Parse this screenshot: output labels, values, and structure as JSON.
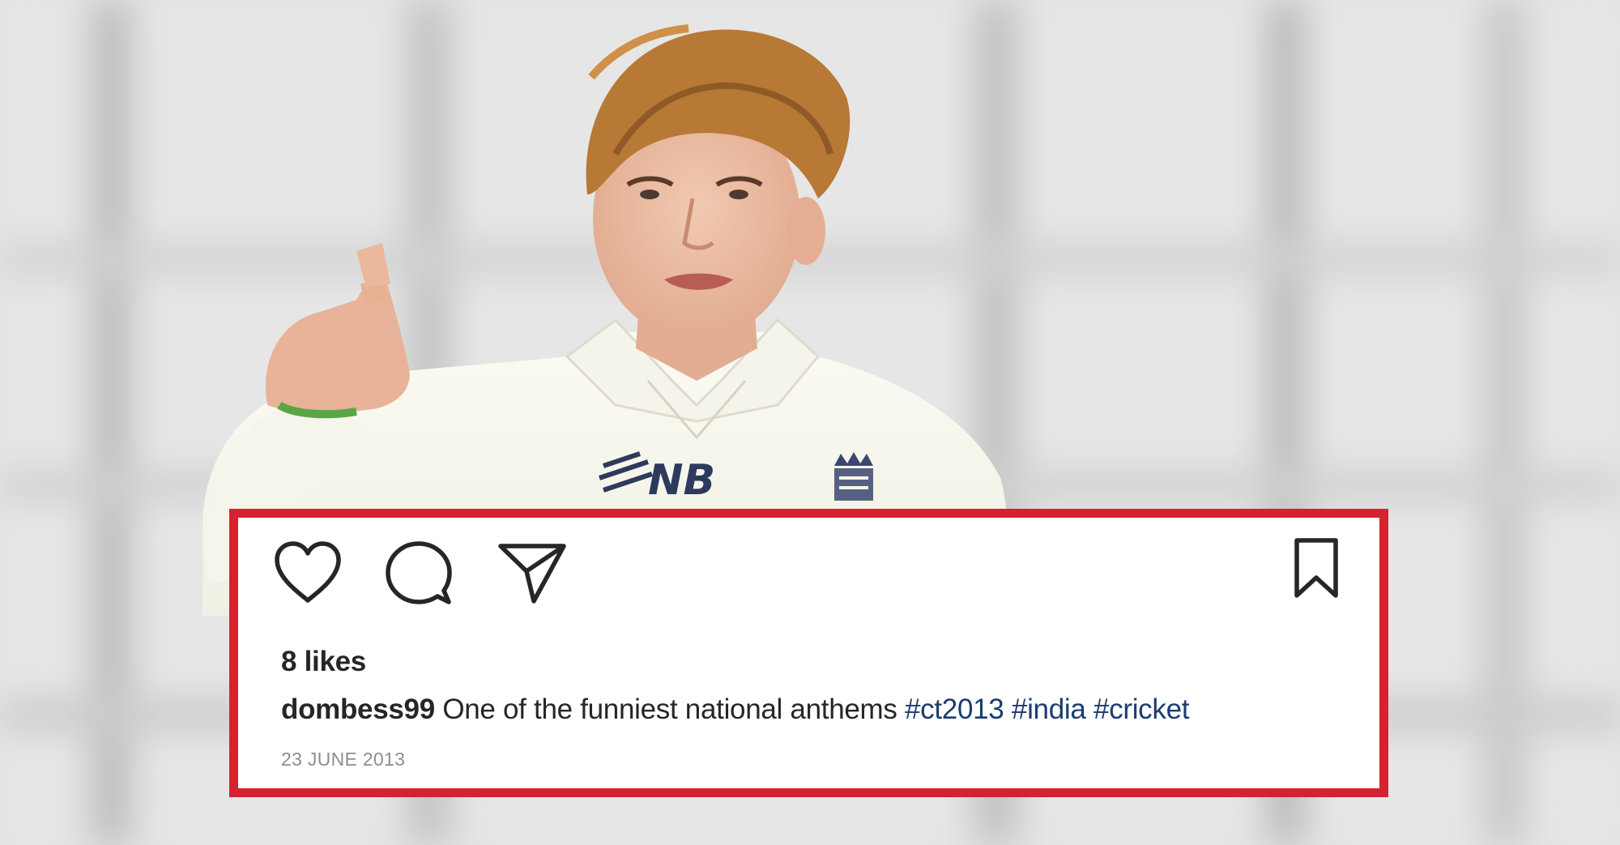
{
  "post": {
    "likes": "8 likes",
    "username": "dombess99",
    "caption_text": "One of the funniest national anthems",
    "hashtags": [
      "#ct2013",
      "#india",
      "#cricket"
    ],
    "date": "23 JUNE 2013"
  },
  "photo": {
    "shirt_logo_text": "NB"
  },
  "icons": {
    "like": "heart-icon",
    "comment": "comment-bubble-icon",
    "share": "paper-plane-icon",
    "save": "bookmark-icon"
  },
  "colors": {
    "border": "#d52130",
    "card": "#ffffff",
    "text": "#262626",
    "hashtag": "#1a3d6e",
    "date": "#8e8e8e",
    "background": "#e4e4e4"
  }
}
